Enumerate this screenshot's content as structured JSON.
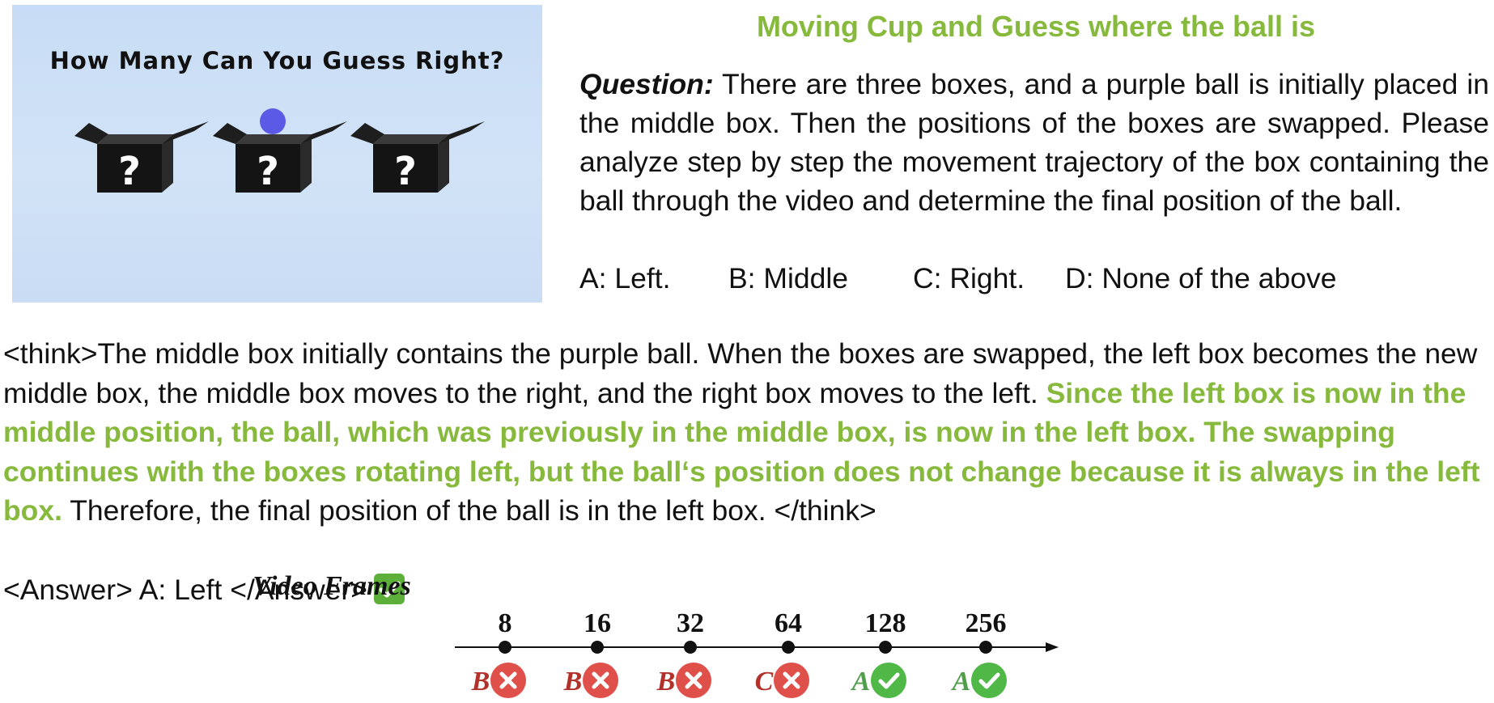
{
  "thumbnail": {
    "title": "How Many Can You Guess Right?",
    "box_mark": "?",
    "ball_color": "#5a5ae6"
  },
  "header": {
    "title": "Moving Cup and Guess where the ball is"
  },
  "question": {
    "label": "Question:",
    "text": " There are three boxes, and a purple ball is initially placed in the middle box. Then the positions of the boxes are swapped. Please analyze step by step the movement trajectory of the box containing the ball through the video and determine the final position of the ball.",
    "options": [
      "A: Left.",
      "B: Middle",
      "C: Right.",
      "D: None of the above"
    ]
  },
  "reasoning": {
    "part1": "<think>The middle box initially contains the purple ball. When the boxes are swapped, the left box becomes the new middle box, the middle box moves to the right, and the right box moves to the left. ",
    "highlight": "Since the left box is now in the middle position, the ball, which was previously in the middle box, is now in the left box. The swapping continues with the boxes rotating left, but the ball‘s position does not change because it is always in the left box.",
    "part2": " Therefore, the final position of the ball is in the left box. </think>",
    "highlight_color": "#86b93c"
  },
  "answer": {
    "text": "<Answer> A: Left </Answer>",
    "icon": "check-mark-button-icon"
  },
  "timeline": {
    "title": "Video Frames",
    "frames": [
      {
        "count": "8",
        "answer": "B",
        "correct": false
      },
      {
        "count": "16",
        "answer": "B",
        "correct": false
      },
      {
        "count": "32",
        "answer": "B",
        "correct": false
      },
      {
        "count": "64",
        "answer": "C",
        "correct": false
      },
      {
        "count": "128",
        "answer": "A",
        "correct": true
      },
      {
        "count": "256",
        "answer": "A",
        "correct": true
      }
    ],
    "colors": {
      "wrong": "#e0504a",
      "right": "#4fb847",
      "wrong_text": "#b3312b",
      "right_text": "#4f9e49"
    }
  }
}
